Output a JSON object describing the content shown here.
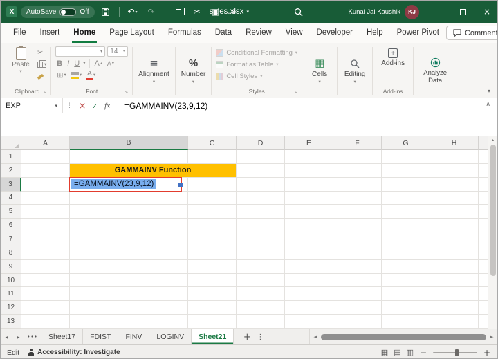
{
  "icons": {
    "app_x": "X",
    "dropdown": "▾",
    "tri_up": "▴",
    "tri_down": "▾",
    "chevron_up": "∧",
    "undo": "↶",
    "redo": "↷",
    "scissors": "✂",
    "picture": "▣",
    "more": "»",
    "minimize": "—",
    "close": "×",
    "cancel": "×",
    "check": "✓",
    "fx": "fx",
    "kebab": "⋮",
    "ellipsis": "•••",
    "plus": "+",
    "minus": "−",
    "nav_left": "◂",
    "nav_right": "▸",
    "scroll_left": "◄",
    "scroll_right": "►",
    "launcher": "↘",
    "borders": "⊞",
    "align": "≡",
    "percent": "%",
    "letter_a": "A",
    "grid_icon": "▦",
    "view_normal": "▦",
    "view_layout": "▤",
    "view_break": "▥"
  },
  "titlebar": {
    "autosave_label": "AutoSave",
    "autosave_state": "Off",
    "filename": "sales.xlsx",
    "user_name": "Kunal Jai Kaushik",
    "user_initials": "KJ"
  },
  "menubar": {
    "items": [
      "File",
      "Insert",
      "Home",
      "Page Layout",
      "Formulas",
      "Data",
      "Review",
      "View",
      "Developer",
      "Help",
      "Power Pivot"
    ],
    "active_item": "Home",
    "comments_label": "Comments"
  },
  "ribbon": {
    "paste": "Paste",
    "clipboard_group": "Clipboard",
    "font_group": "Font",
    "font_size": "14",
    "bold": "B",
    "italic": "I",
    "underline": "U",
    "alignment": "Alignment",
    "number": "Number",
    "styles_items": [
      "Conditional Formatting",
      "Format as Table",
      "Cell Styles"
    ],
    "styles_group": "Styles",
    "cells": "Cells",
    "editing": "Editing",
    "addins": "Add-ins",
    "analyze_data": "Analyze Data"
  },
  "formula_bar": {
    "name_box": "EXP",
    "formula": "=GAMMAINV(23,9,12)"
  },
  "grid": {
    "columns": [
      "A",
      "B",
      "C",
      "D",
      "E",
      "F",
      "G",
      "H"
    ],
    "rows": [
      "1",
      "2",
      "3",
      "4",
      "5",
      "6",
      "7",
      "8",
      "9",
      "10",
      "11",
      "12",
      "13"
    ],
    "b2_text": "GAMMAINV Function",
    "b3_text": "=GAMMAINV(23,9,12)",
    "b2_fill": "#FFC000",
    "selected_cell": "B3"
  },
  "tabbar": {
    "tabs": [
      "Sheet17",
      "FDIST",
      "FINV",
      "LOGINV",
      "Sheet21"
    ],
    "active_tab": "Sheet21"
  },
  "statusbar": {
    "mode": "Edit",
    "accessibility": "Accessibility: Investigate"
  },
  "colors": {
    "titlebar_green": "#185C37",
    "accent_green": "#107C41",
    "header_fill": "#FFC000",
    "selection_blue": "#79aeee",
    "annotation_red": "#e23c2e",
    "avatar": "#8e3b45"
  }
}
